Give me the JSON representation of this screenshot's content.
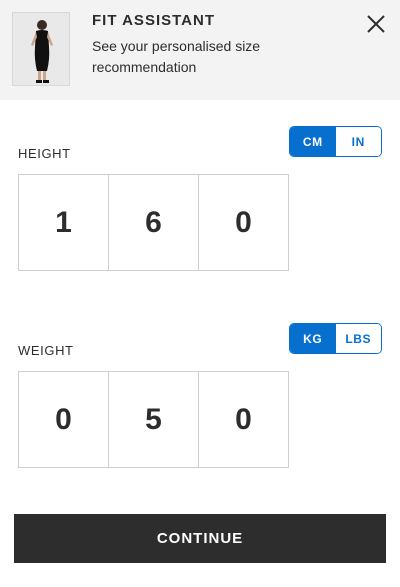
{
  "header": {
    "title": "FIT ASSISTANT",
    "subtitle": "See your personalised size recommendation",
    "close_icon": "close-icon",
    "product_image": "product-thumbnail"
  },
  "height": {
    "label": "HEIGHT",
    "units": {
      "selected": "CM",
      "options": [
        "CM",
        "IN"
      ]
    },
    "digits": [
      "1",
      "6",
      "0"
    ]
  },
  "weight": {
    "label": "WEIGHT",
    "units": {
      "selected": "KG",
      "options": [
        "KG",
        "LBS"
      ]
    },
    "digits": [
      "0",
      "5",
      "0"
    ]
  },
  "continue_label": "CONTINUE",
  "colors": {
    "accent": "#0770cf",
    "dark": "#2d2d2d",
    "header_bg": "#f3f3f3"
  }
}
